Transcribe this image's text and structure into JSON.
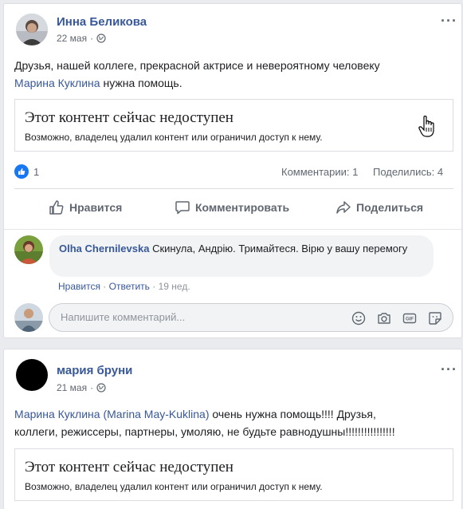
{
  "posts": [
    {
      "author": "Инна Беликова",
      "date": "22 мая",
      "text_line1": "Друзья, нашей коллеге, прекрасной актрисе и невероятному человеку",
      "mention": "Марина Куклина",
      "text_after_mention": " нужна помощь.",
      "unavailable_title": "Этот контент сейчас недоступен",
      "unavailable_sub": "Возможно, владелец удалил контент или ограничил доступ к нему.",
      "like_count": "1",
      "comments_stat": "Комментарии: 1",
      "shares_stat": "Поделились: 4",
      "actions": {
        "like": "Нравится",
        "comment": "Комментировать",
        "share": "Поделиться"
      },
      "comment": {
        "author": "Olha Chernilevska",
        "text": " Скинула, Андрію. Тримайтеся. Вірю у вашу перемогу",
        "like": "Нравится",
        "reply": "Ответить",
        "sep": " · ",
        "time": "19 нед."
      },
      "comment_placeholder": "Напишите комментарий..."
    },
    {
      "author": "мария бруни",
      "date": "21 мая",
      "mention": "Марина Куклина (Marina May-Kuklina)",
      "text_after_mention": " очень нужна помощь!!!! Друзья,",
      "text_line2": "коллеги, режиссеры, партнеры, умоляю, не будьте равнодушны!!!!!!!!!!!!!!!!",
      "unavailable_title": "Этот контент сейчас недоступен",
      "unavailable_sub": "Возможно, владелец удалил контент или ограничил доступ к нему."
    }
  ],
  "colors": {
    "link": "#385898",
    "like_blue": "#1877f2",
    "background": "#e9ebee"
  },
  "icons": [
    "globe-icon",
    "more-icon",
    "thumbs-up-icon",
    "comment-icon",
    "share-icon",
    "emoji-icon",
    "camera-icon",
    "gif-icon",
    "sticker-icon",
    "hand-cursor-icon"
  ]
}
